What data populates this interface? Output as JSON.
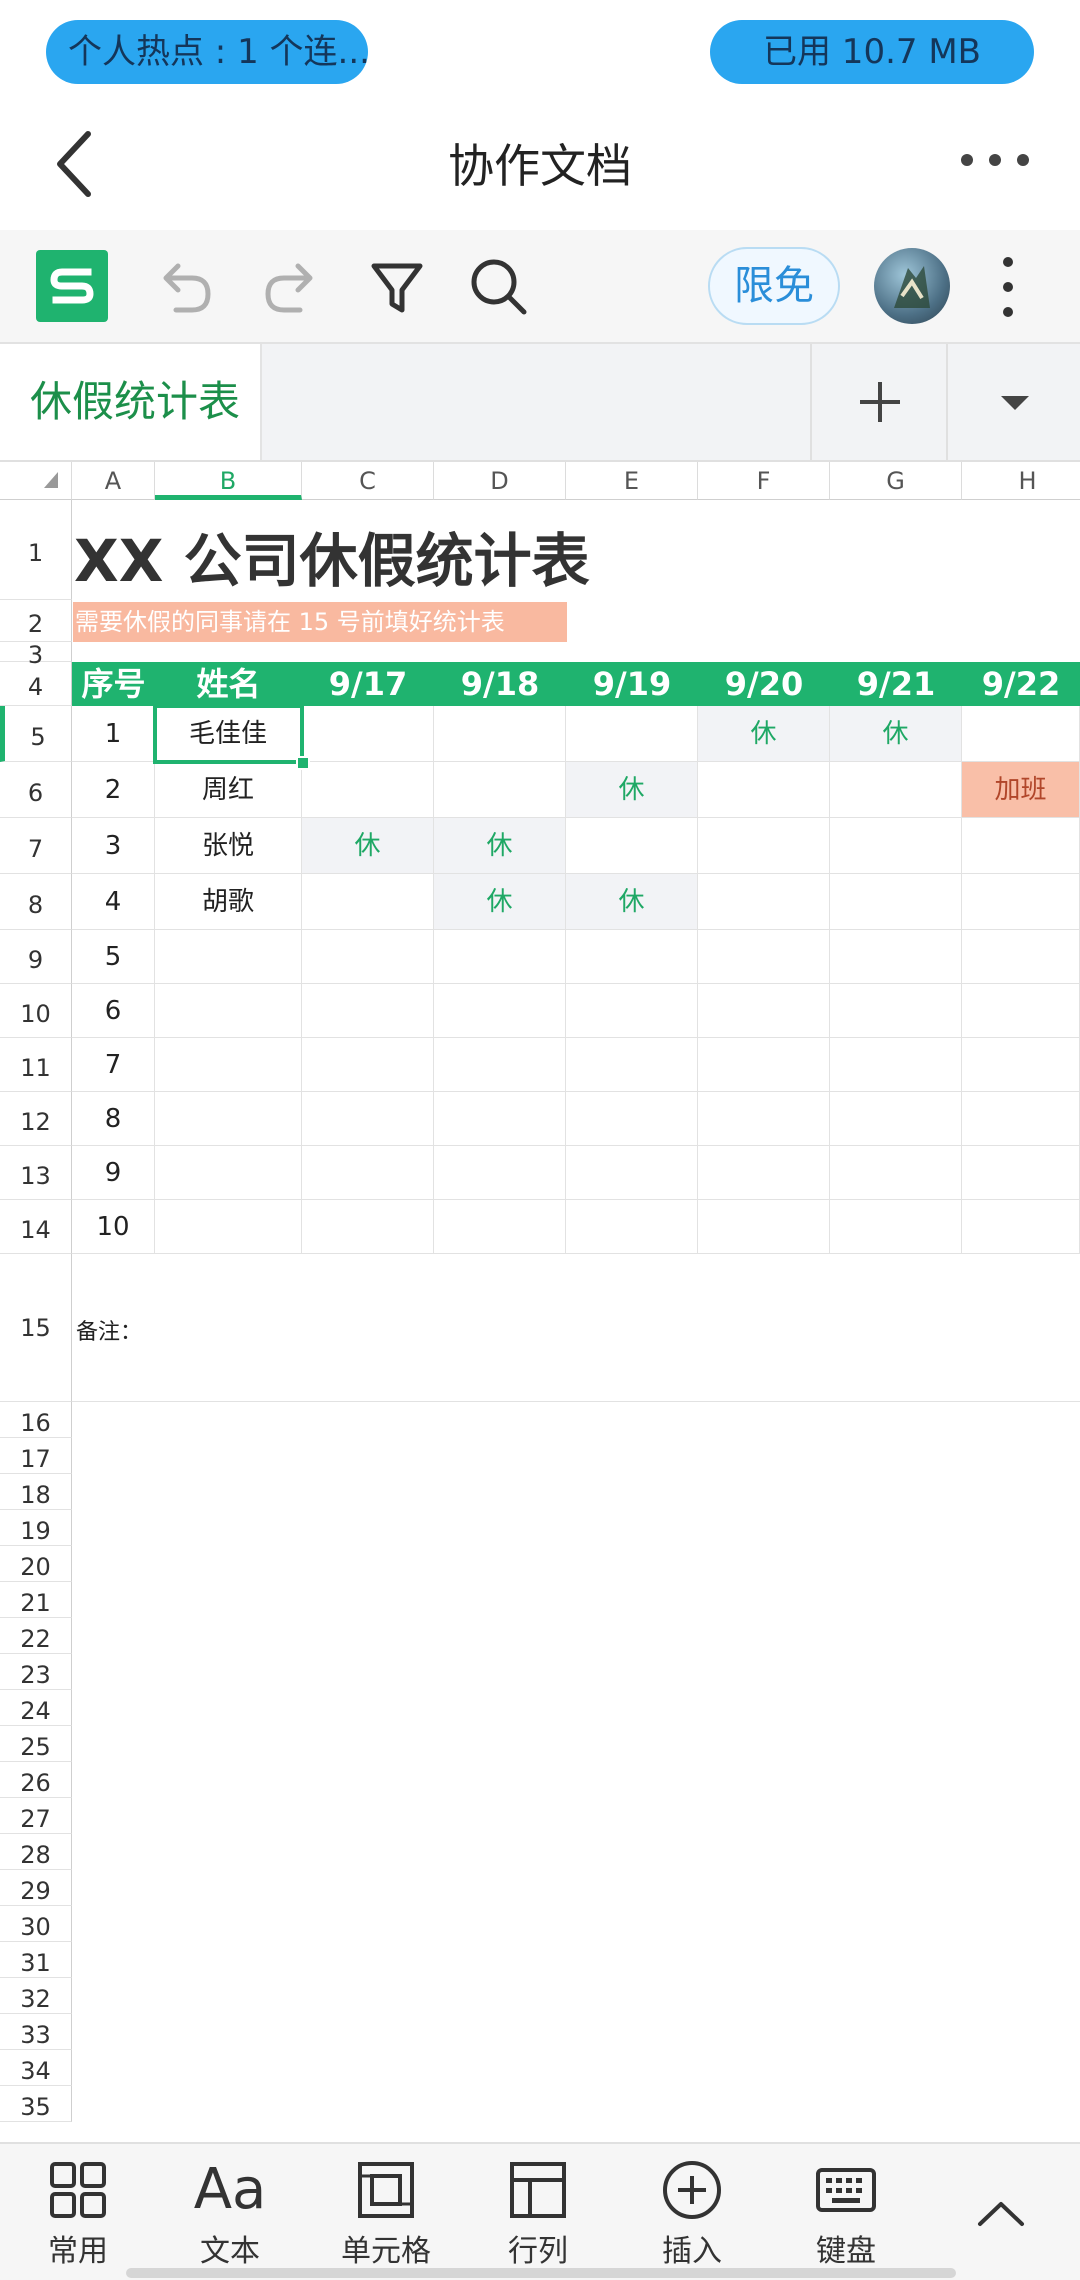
{
  "status_bar": {
    "hotspot_text": "个人热点 : 1 个连...",
    "data_used": "已用 10.7 MB"
  },
  "header": {
    "title": "协作文档"
  },
  "toolbar": {
    "app_logo": "S",
    "limit_label": "限免"
  },
  "sheet_tabs": {
    "active_tab": "休假统计表"
  },
  "grid": {
    "columns": [
      "A",
      "B",
      "C",
      "D",
      "E",
      "F",
      "G",
      "H"
    ],
    "selected_column": "B",
    "rows": [
      "1",
      "2",
      "3",
      "4",
      "5",
      "6",
      "7",
      "8",
      "9",
      "10",
      "11",
      "12",
      "13",
      "14",
      "15",
      "16",
      "17",
      "18",
      "19",
      "20",
      "21",
      "22",
      "23",
      "24",
      "25",
      "26",
      "27",
      "28",
      "29",
      "30",
      "31",
      "32",
      "33",
      "34",
      "35"
    ],
    "selected_row": "5",
    "title": "XX 公司休假统计表",
    "notice": "需要休假的同事请在 15 号前填好统计表",
    "table_header": [
      "序号",
      "姓名",
      "9/17",
      "9/18",
      "9/19",
      "9/20",
      "9/21",
      "9/22"
    ],
    "table_rows": [
      {
        "no": "1",
        "name": "毛佳佳",
        "days": [
          "",
          "",
          "",
          "休",
          "休",
          ""
        ]
      },
      {
        "no": "2",
        "name": "周红",
        "days": [
          "",
          "",
          "休",
          "",
          "",
          "加班"
        ]
      },
      {
        "no": "3",
        "name": "张悦",
        "days": [
          "休",
          "休",
          "",
          "",
          "",
          ""
        ]
      },
      {
        "no": "4",
        "name": "胡歌",
        "days": [
          "",
          "休",
          "休",
          "",
          "",
          ""
        ]
      },
      {
        "no": "5",
        "name": "",
        "days": [
          "",
          "",
          "",
          "",
          "",
          ""
        ]
      },
      {
        "no": "6",
        "name": "",
        "days": [
          "",
          "",
          "",
          "",
          "",
          ""
        ]
      },
      {
        "no": "7",
        "name": "",
        "days": [
          "",
          "",
          "",
          "",
          "",
          ""
        ]
      },
      {
        "no": "8",
        "name": "",
        "days": [
          "",
          "",
          "",
          "",
          "",
          ""
        ]
      },
      {
        "no": "9",
        "name": "",
        "days": [
          "",
          "",
          "",
          "",
          "",
          ""
        ]
      },
      {
        "no": "10",
        "name": "",
        "days": [
          "",
          "",
          "",
          "",
          "",
          ""
        ]
      }
    ],
    "remark_label": "备注："
  },
  "bottom_bar": {
    "items": [
      "常用",
      "文本",
      "单元格",
      "行列",
      "插入",
      "键盘"
    ],
    "text_icon_glyph": "Aa"
  },
  "colors": {
    "accent": "#1fb36f",
    "leave_text": "#1fa865",
    "overtime_bg": "#f9bfa8",
    "notice_bg": "#f9b9a0",
    "limit_btn": "#2a8ed9",
    "pill_bg": "#2aa6f0"
  }
}
